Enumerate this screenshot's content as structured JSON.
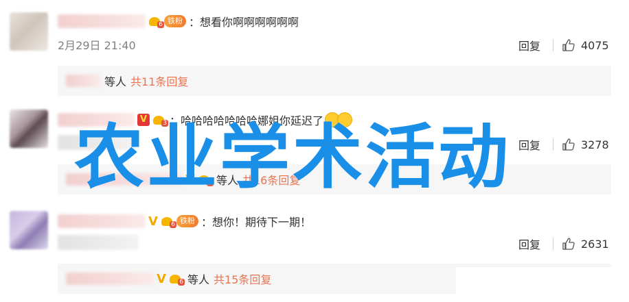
{
  "comments": [
    {
      "badge_fan": "铁粉",
      "text": "想看你啊啊啊啊啊啊",
      "timestamp": "2月29日 21:40",
      "reply_label": "回复",
      "like_count": "4075",
      "replies_by": "等人",
      "replies_total": "共11条回复"
    },
    {
      "text": "哈哈哈哈哈哈哈娜姐你延迟了",
      "reply_label": "回复",
      "like_count": "3278",
      "replies_by": "等人",
      "replies_total": "共16条回复"
    },
    {
      "badge_fan": "铁粉",
      "text": "想你！期待下一期！",
      "reply_label": "回复",
      "like_count": "2631",
      "replies_by": "等人",
      "replies_total": "共15条回复"
    }
  ],
  "watermark": "农业学术活动",
  "colors": {
    "accent_orange": "#eb7350",
    "watermark_blue": "#1a8fe8",
    "reply_bg": "#f6f6f6"
  },
  "icons": {
    "like": "thumbs-up-icon",
    "vip": "crown-icon",
    "verified": "v-badge-icon"
  }
}
